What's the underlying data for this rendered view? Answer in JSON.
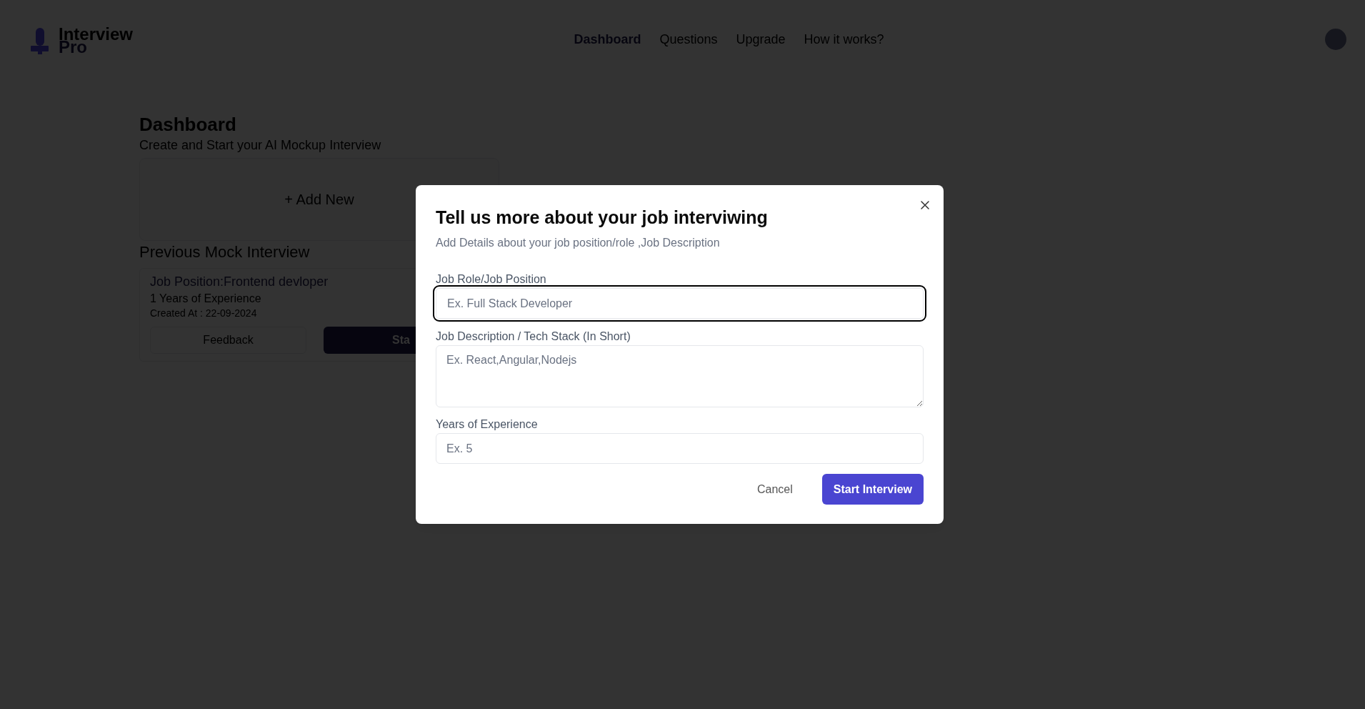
{
  "header": {
    "logo": {
      "name": "Interview",
      "suffix": "Pro"
    },
    "nav": [
      {
        "label": "Dashboard",
        "selected": true
      },
      {
        "label": "Questions",
        "selected": false
      },
      {
        "label": "Upgrade",
        "selected": false
      },
      {
        "label": "How it works?",
        "selected": false
      }
    ]
  },
  "dashboard": {
    "title": "Dashboard",
    "subtitle": "Create and Start your AI Mockup Interview",
    "add_new": "+ Add New",
    "section_title": "Previous Mock Interview",
    "interviews": [
      {
        "position": "Job Position:Frontend devloper",
        "experience": "1 Years of Experience",
        "created": "Created At : 22-09-2024",
        "buttons": [
          {
            "label": "Feedback",
            "kind": "outline"
          },
          {
            "label": "Sta",
            "kind": "primary"
          }
        ]
      }
    ]
  },
  "dialog": {
    "title": "Tell us more about your job interviwing",
    "subtitle": "Add Details about your job position/role ,Job Description",
    "fields": [
      {
        "kind": "input",
        "label": "Job Role/Job Position",
        "placeholder": "Ex. Full Stack Developer",
        "focused": true
      },
      {
        "kind": "textarea",
        "label": "Job Description / Tech Stack (In Short)",
        "placeholder": "Ex. React,Angular,Nodejs",
        "focused": false
      },
      {
        "kind": "input",
        "label": "Years of Experience",
        "placeholder": "Ex. 5",
        "focused": false
      }
    ],
    "buttons": [
      {
        "label": "Cancel",
        "kind": "ghost"
      },
      {
        "label": "Start Interview",
        "kind": "primary"
      }
    ]
  }
}
